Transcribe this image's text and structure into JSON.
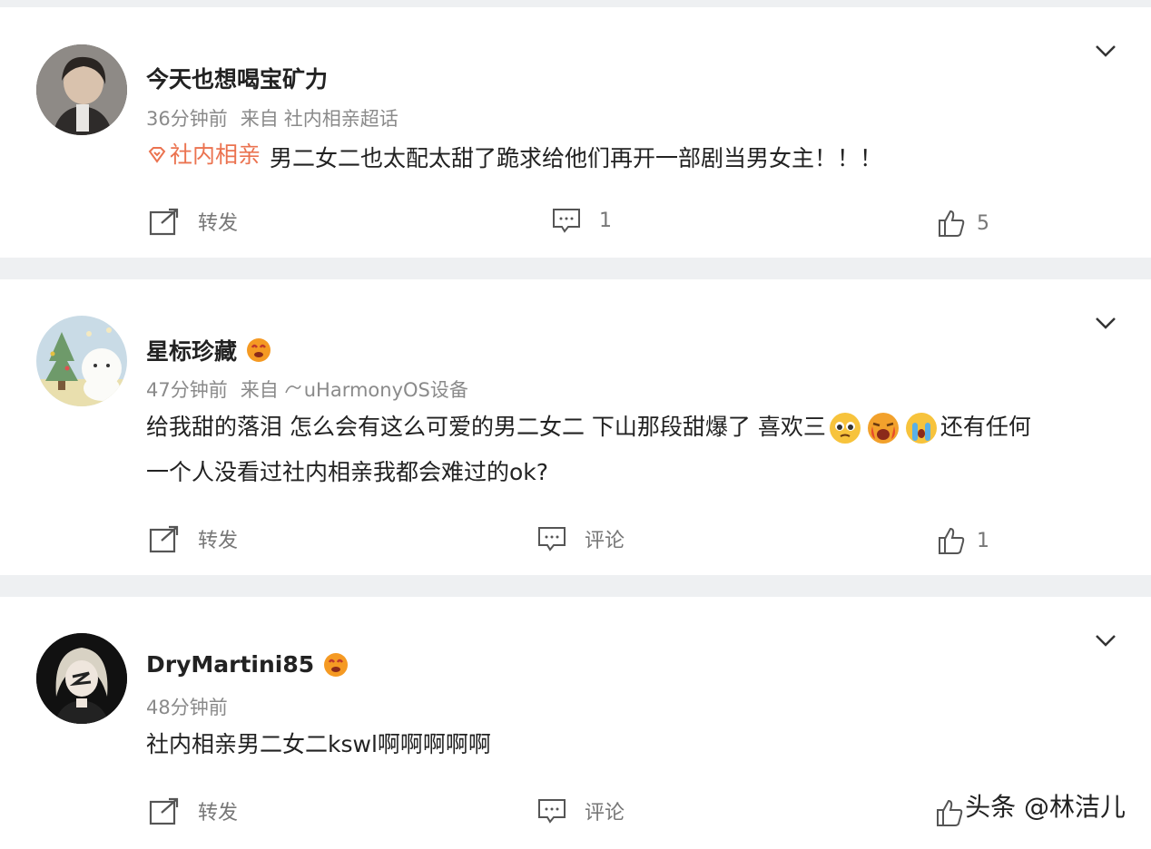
{
  "posts": [
    {
      "username": "今天也想喝宝矿力",
      "time": "36分钟前",
      "from": "来自",
      "source": "社内相亲超话",
      "topic": "社内相亲",
      "text": "男二女二也太配太甜了跪求给他们再开一部剧当男女主！！！",
      "repost_label": "转发",
      "comment_label": "1",
      "like_count": "5"
    },
    {
      "username": "星标珍藏",
      "time": "47分钟前",
      "from": "来自",
      "source": "uHarmonyOS设备",
      "text_line1a": "给我甜的落泪 怎么会有这么可爱的男二女二 下山那段甜爆了 喜欢三",
      "text_line1b": "还有任何",
      "text_line2": "一个人没看过社内相亲我都会难过的ok?",
      "repost_label": "转发",
      "comment_label": "评论",
      "like_count": "1"
    },
    {
      "username": "DryMartini85",
      "time": "48分钟前",
      "text": "社内相亲男二女二kswl啊啊啊啊啊",
      "repost_label": "转发",
      "comment_label": "评论"
    }
  ],
  "watermark": "头条 @林洁儿",
  "colors": {
    "background": "#eef0f2",
    "card": "#ffffff",
    "topic_accent": "#eb7350",
    "meta_gray": "#8a8a8a"
  }
}
